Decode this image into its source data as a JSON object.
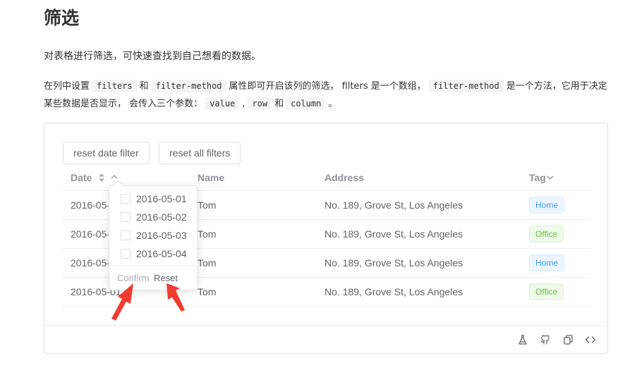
{
  "page": {
    "title": "筛选",
    "description": "对表格进行筛选，可快速查找到自己想看的数据。",
    "detail": {
      "p1": "在列中设置",
      "code_filters": "filters",
      "p2": "和",
      "code_filter_method": "filter-method",
      "p3": "属性即可开启该列的筛选， filters 是一个数组，",
      "code_filter_method_2": "filter-method",
      "p4": "是一个方法，它用于决定某些数据是否显示， 会传入三个参数：",
      "code_value": "value",
      "sep1": ",",
      "code_row": "row",
      "p5": "和",
      "code_column": "column",
      "p6": "。"
    }
  },
  "demo": {
    "buttons": {
      "reset_date": "reset date filter",
      "reset_all": "reset all filters"
    },
    "columns": {
      "date": "Date",
      "name": "Name",
      "address": "Address",
      "tag": "Tag"
    },
    "rows": [
      {
        "date": "2016-05-",
        "name": "Tom",
        "address": "No. 189, Grove St, Los Angeles",
        "tag": "Home"
      },
      {
        "date": "2016-05-",
        "name": "Tom",
        "address": "No. 189, Grove St, Los Angeles",
        "tag": "Office"
      },
      {
        "date": "2016-05-",
        "name": "Tom",
        "address": "No. 189, Grove St, Los Angeles",
        "tag": "Home"
      },
      {
        "date": "2016-05-01",
        "name": "Tom",
        "address": "No. 189, Grove St, Los Angeles",
        "tag": "Office"
      }
    ],
    "filter_popover": {
      "options": [
        "2016-05-01",
        "2016-05-02",
        "2016-05-03",
        "2016-05-04"
      ],
      "confirm": "Confirm",
      "reset": "Reset"
    },
    "footer_icons": [
      "flask-icon",
      "github-icon",
      "copy-icon",
      "code-icon"
    ]
  },
  "colors": {
    "home_tag": "#409eff",
    "office_tag": "#67c23a",
    "annotation_arrow": "#f23c30"
  }
}
